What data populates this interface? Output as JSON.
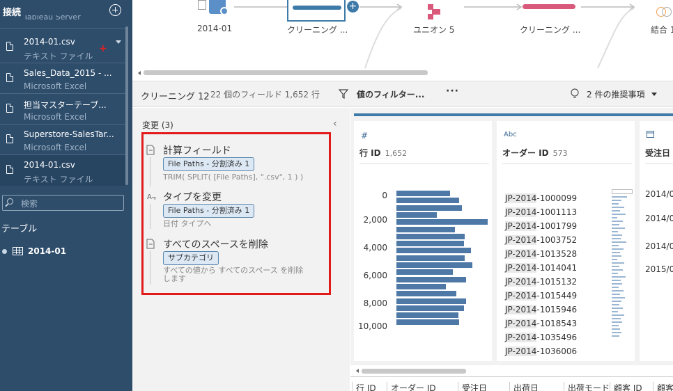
{
  "sidebar": {
    "connections_title": "接続",
    "server_partial": "Tableau Server",
    "items": [
      {
        "name": "2014-01.csv",
        "type": "テキスト ファイル"
      },
      {
        "name": "Sales_Data_2015 - ...",
        "type": "Microsoft Excel"
      },
      {
        "name": "担当マスターテーブ...",
        "type": "Microsoft Excel"
      },
      {
        "name": "Superstore-SalesTar...",
        "type": "Microsoft Excel"
      },
      {
        "name": "2014-01.csv",
        "type": "テキスト ファイル"
      }
    ],
    "search_placeholder": "検索",
    "tables_title": "テーブル",
    "table_name": "2014-01"
  },
  "flow": {
    "nodes": [
      {
        "label": "2014-01"
      },
      {
        "label": "クリーニング ..."
      },
      {
        "label": "ユニオン 5"
      },
      {
        "label": "クリーニング ..."
      },
      {
        "label": "結合 1"
      }
    ],
    "colors": {
      "input": "#5b8fc7",
      "clean": "#3e7aa8",
      "union": "#d9597b",
      "clean2": "#d9597b",
      "join_left": "#f0a050"
    }
  },
  "step": {
    "title": "クリーニング 12",
    "meta": "22 個のフィールド  1,652 行",
    "filter_label": "値のフィルター...",
    "more": "···",
    "recommendations": "2 件の推奨事項"
  },
  "changes": {
    "header": "変更 (3)",
    "items": [
      {
        "title": "計算フィールド",
        "chip": "File Paths - 分割済み 1",
        "desc": "TRIM( SPLIT( [File Paths], \".csv\", 1 ) )",
        "icon": "calc-field-icon"
      },
      {
        "title": "タイプを変更",
        "chip": "File Paths - 分割済み 1",
        "desc": "日付 タイプへ",
        "icon": "change-type-icon"
      },
      {
        "title": "すべてのスペースを削除",
        "chip": "サブカテゴリ",
        "desc": "すべての値から すべてのスペース を削除します",
        "icon": "clean-icon"
      }
    ],
    "highlight_color": "#e21a1a"
  },
  "profile": {
    "row_id": {
      "type_icon": "#",
      "name": "行 ID",
      "count": "1,652",
      "y_ticks": [
        "0",
        "2,000",
        "4,000",
        "6,000",
        "8,000",
        "10,000"
      ],
      "bins": [
        0.59,
        0.69,
        0.72,
        0.44,
        1.0,
        0.64,
        0.75,
        0.74,
        0.82,
        0.75,
        0.83,
        0.62,
        0.76,
        0.54,
        0.66,
        0.76,
        0.74,
        0.68,
        0.69
      ],
      "bar_color": "#4e79a7"
    },
    "order_id": {
      "type_icon": "Abc",
      "name": "オーダー ID",
      "count": "573",
      "values": [
        "JP-2014-1000099",
        "JP-2014-1001113",
        "JP-2014-1001799",
        "JP-2014-1003752",
        "JP-2014-1013528",
        "JP-2014-1014041",
        "JP-2014-1015132",
        "JP-2014-1015449",
        "JP-2014-1015946",
        "JP-2014-1018543",
        "JP-2014-1035496",
        "JP-2014-1036006"
      ]
    },
    "order_date": {
      "type_icon": "calendar-icon",
      "name": "受注日",
      "values": [
        "2014/0",
        "2014/0",
        "2014/0",
        "2015/0"
      ]
    }
  },
  "grid": {
    "columns": [
      "行 ID",
      "オーダー ID",
      "受注日",
      "出荷日",
      "出荷モード",
      "顧客 ID",
      "顧客"
    ]
  }
}
